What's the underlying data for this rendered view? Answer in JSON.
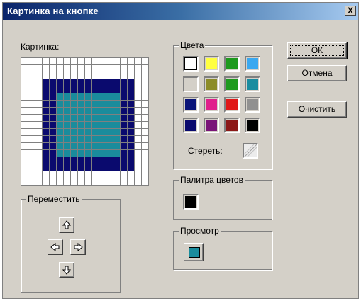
{
  "window": {
    "title": "Картинка на кнопке",
    "close_glyph": "X"
  },
  "picture": {
    "label": "Картинка:",
    "rows": 18,
    "cols": 18,
    "colors": {
      "empty": "#ffffff",
      "frame": "#0a0a6e",
      "fill": "#1a8c9c"
    },
    "frame_rows": [
      3,
      15
    ],
    "frame_cols": [
      3,
      15
    ],
    "fill_rows": [
      5,
      13
    ],
    "fill_cols": [
      5,
      13
    ]
  },
  "colors_group": {
    "legend": "Цвета",
    "swatches": [
      "#ffffff",
      "#ffff40",
      "#1e9a1e",
      "#3aa8f0",
      "#d4d0c8",
      "#8c8c28",
      "#1e9a1e",
      "#1a8ca0",
      "#0a1478",
      "#e0208c",
      "#e01818",
      "#909090",
      "#0a0a6e",
      "#7a1478",
      "#8c1818",
      "#000000"
    ],
    "selected_index": 0,
    "erase_label": "Стереть:"
  },
  "palette_group": {
    "legend": "Палитра цветов",
    "current_color": "#000000"
  },
  "preview_group": {
    "legend": "Просмотр",
    "preview_color": "#1a8c9c"
  },
  "move_group": {
    "legend": "Переместить",
    "buttons": [
      "up-arrow-icon",
      "left-arrow-icon",
      "right-arrow-icon",
      "down-arrow-icon"
    ]
  },
  "buttons": {
    "ok": "ОК",
    "cancel": "Отмена",
    "clear": "Очистить"
  }
}
